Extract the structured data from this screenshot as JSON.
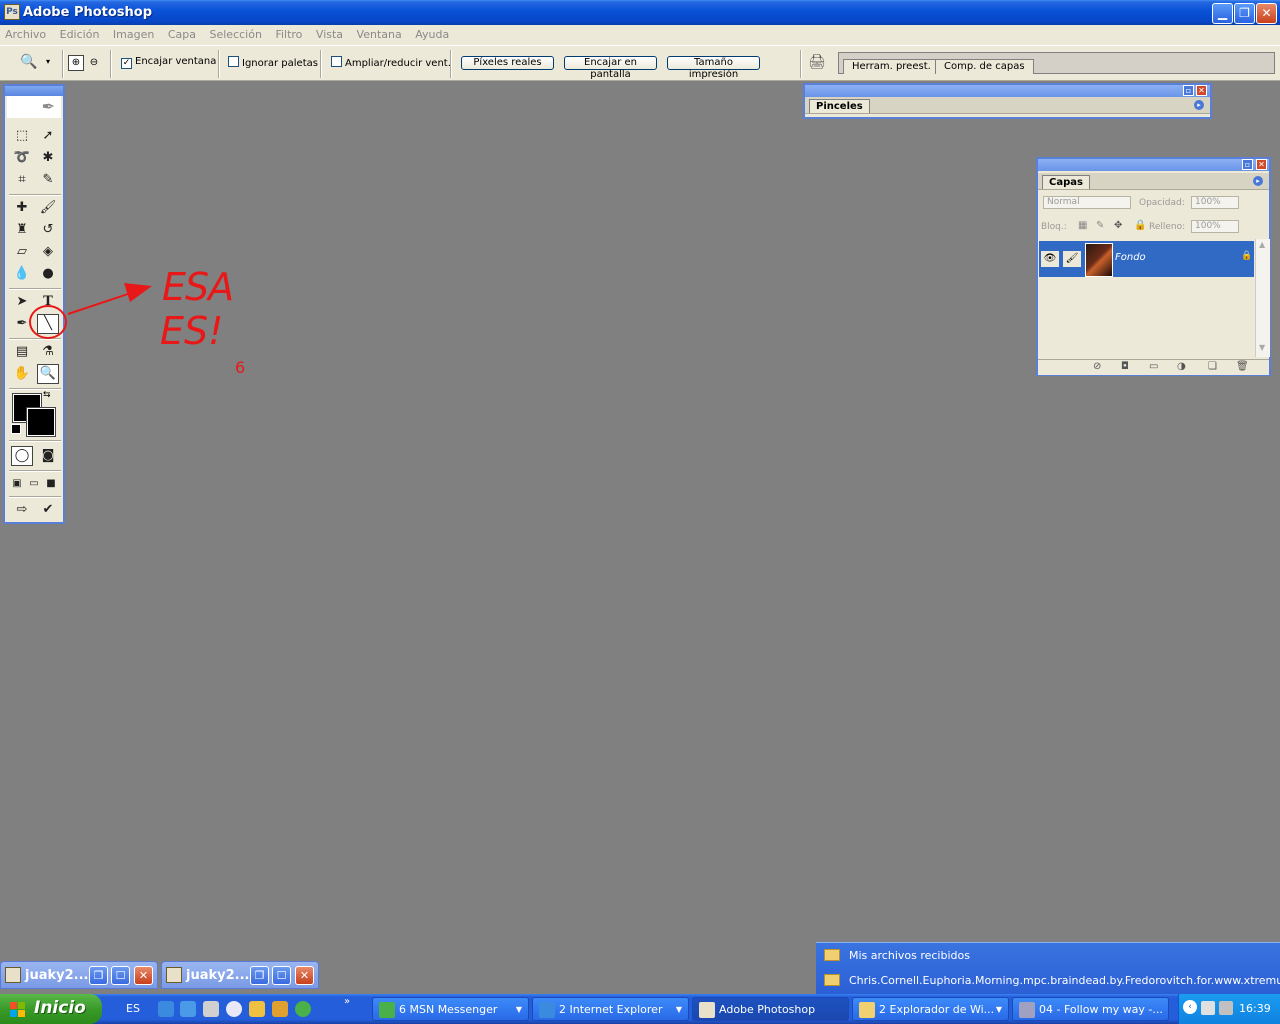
{
  "window": {
    "title": "Adobe Photoshop",
    "icon": "photoshop-icon",
    "controls": [
      "minimize-icon",
      "restore-icon",
      "close-icon"
    ]
  },
  "menu": [
    "Archivo",
    "Edición",
    "Imagen",
    "Capa",
    "Selección",
    "Filtro",
    "Vista",
    "Ventana",
    "Ayuda"
  ],
  "options": {
    "fit_window": "Encajar ventana",
    "ignore_palettes": "Ignorar paletas",
    "resize_windows": "Ampliar/reducir vent.",
    "actual_pixels": "Píxeles reales",
    "fit_screen": "Encajar en pantalla",
    "print_size": "Tamaño impresión",
    "fit_window_checked": true,
    "ignore_palettes_checked": false,
    "resize_windows_checked": false,
    "well_tabs": [
      "Herram. preest.",
      "Comp. de capas"
    ]
  },
  "brushes_panel": {
    "tab": "Pinceles"
  },
  "layers_panel": {
    "tab": "Capas",
    "blend_mode": "Normal",
    "opacity_label": "Opacidad:",
    "opacity_value": "100%",
    "lock_label": "Bloq.:",
    "fill_label": "Relleno:",
    "fill_value": "100%",
    "layer_name": "Fondo"
  },
  "annotation": {
    "line1": "ESA",
    "line2": "ES!",
    "note": "6",
    "color": "#e81818"
  },
  "minimized": [
    {
      "title": "juaky2..."
    },
    {
      "title": "juaky2..."
    }
  ],
  "popup": {
    "items": [
      "Mis archivos recibidos",
      "Chris.Cornell.Euphoria.Morning.mpc.braindead.by.Fredorovitch.for.www.xtremule.n"
    ]
  },
  "taskbar": {
    "start": "Inicio",
    "lang": "ES",
    "items": [
      {
        "label": "6 MSN Messenger"
      },
      {
        "label": "2 Internet Explorer"
      },
      {
        "label": "Adobe Photoshop"
      },
      {
        "label": "2 Explorador de Wi..."
      },
      {
        "label": "04 - Follow my way  -..."
      }
    ],
    "clock": "16:39"
  }
}
